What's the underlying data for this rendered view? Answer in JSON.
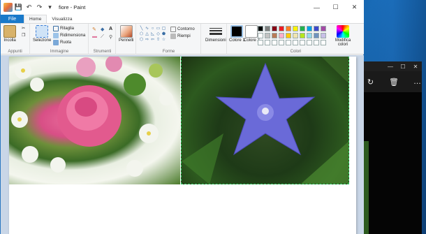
{
  "window": {
    "title": "fiore - Paint",
    "controls": {
      "minimize": "—",
      "maximize": "☐",
      "close": "✕"
    }
  },
  "tabs": {
    "file": "File",
    "home": "Home",
    "view": "Visualizza"
  },
  "ribbon": {
    "appunti": {
      "label": "Appunti",
      "paste": "Incolla"
    },
    "immagine": {
      "label": "Immagine",
      "select": "Selezione",
      "crop": "Ritaglia",
      "resize": "Ridimensiona",
      "rotate": "Ruota"
    },
    "strumenti": {
      "label": "Strumenti"
    },
    "pennelli": {
      "label": "Pennelli"
    },
    "forme": {
      "label": "Forme",
      "outline": "Contorno",
      "fill": "Riempi"
    },
    "dimensioni": {
      "label": "Dimensioni"
    },
    "colori": {
      "label": "Colori",
      "color1": "Colore 1",
      "color2": "Colore 2",
      "edit": "Modifica colori"
    }
  },
  "palette": [
    "#000000",
    "#7f7f7f",
    "#880015",
    "#ed1c24",
    "#ff7f27",
    "#fff200",
    "#22b14c",
    "#00a2e8",
    "#3f48cc",
    "#a349a4",
    "#ffffff",
    "#c3c3c3",
    "#b97a57",
    "#ffaec9",
    "#ffc90e",
    "#efe4b0",
    "#b5e61d",
    "#99d9ea",
    "#7092be",
    "#c8bfe7",
    "#ffffff",
    "#ffffff",
    "#ffffff",
    "#ffffff",
    "#ffffff",
    "#ffffff",
    "#ffffff",
    "#ffffff",
    "#ffffff",
    "#ffffff"
  ],
  "colors": {
    "accent": "#1979ca",
    "workspace": "#c9d6e7"
  }
}
